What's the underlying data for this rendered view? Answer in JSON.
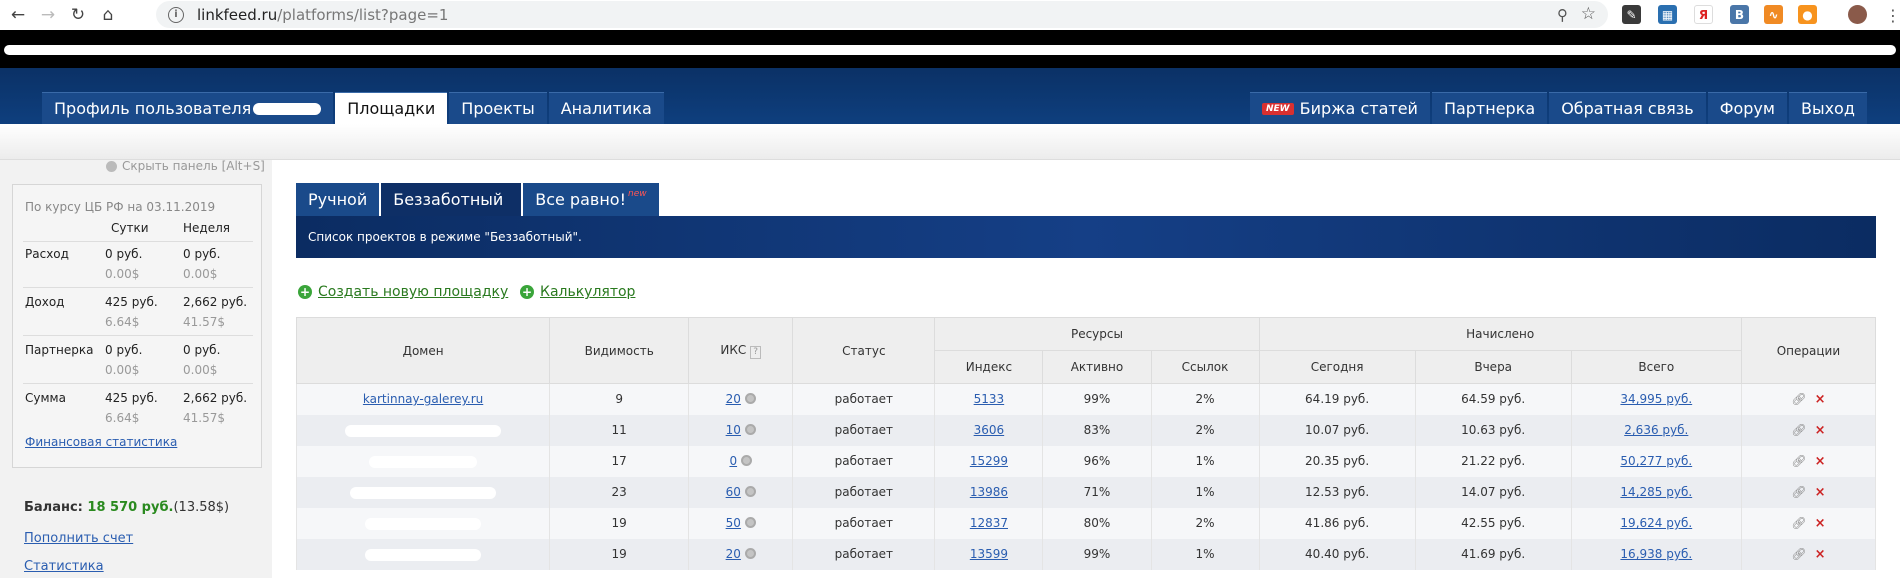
{
  "browser": {
    "url_host": "linkfeed.ru",
    "url_path": "/platforms/list?page=1"
  },
  "header_menu": {
    "left": [
      {
        "label": "Профиль пользователя"
      },
      {
        "label": "Площадки",
        "active": true
      },
      {
        "label": "Проекты"
      },
      {
        "label": "Аналитика"
      }
    ],
    "right": [
      {
        "label": "Биржа статей",
        "badge": "NEW"
      },
      {
        "label": "Партнерка"
      },
      {
        "label": "Обратная связь"
      },
      {
        "label": "Форум"
      },
      {
        "label": "Выход"
      }
    ]
  },
  "sidebar": {
    "hide_panel": "Скрыть панель [Alt+S]",
    "rate_line": "По курсу ЦБ РФ на 03.11.2019",
    "col_day": "Сутки",
    "col_week": "Неделя",
    "rows": [
      {
        "label": "Расход",
        "day_rub": "0 руб.",
        "week_rub": "0 руб.",
        "day_usd": "0.00$",
        "week_usd": "0.00$"
      },
      {
        "label": "Доход",
        "day_rub": "425 руб.",
        "week_rub": "2,662 руб.",
        "day_usd": "6.64$",
        "week_usd": "41.57$"
      },
      {
        "label": "Партнерка",
        "day_rub": "0 руб.",
        "week_rub": "0 руб.",
        "day_usd": "0.00$",
        "week_usd": "0.00$"
      },
      {
        "label": "Сумма",
        "day_rub": "425 руб.",
        "week_rub": "2,662 руб.",
        "day_usd": "6.64$",
        "week_usd": "41.57$"
      }
    ],
    "fin_link": "Финансовая статистика",
    "balance_label": "Баланс:",
    "balance_rub": "18 570 руб.",
    "balance_usd": "(13.58$)",
    "links": [
      "Пополнить счет",
      "Статистика"
    ]
  },
  "tabs": [
    {
      "label": "Ручной"
    },
    {
      "label": "Беззаботный",
      "active": true
    },
    {
      "label": "Все равно!",
      "badge": "new"
    }
  ],
  "banner_text": "Список проектов в режиме \"Беззаботный\".",
  "actions": {
    "create": "Создать новую площадку",
    "calc": "Калькулятор"
  },
  "table": {
    "headers": {
      "domain": "Домен",
      "visibility": "Видимость",
      "iks": "ИКС",
      "iks_hint": "?",
      "status": "Статус",
      "resources": "Ресурсы",
      "index": "Индекс",
      "active": "Активно",
      "links": "Ссылок",
      "accrued": "Начислено",
      "today": "Сегодня",
      "yesterday": "Вчера",
      "total": "Всего",
      "ops": "Операции"
    },
    "rows": [
      {
        "domain": "kartinnay-galerey.ru",
        "visibility": "9",
        "iks": "20",
        "status": "работает",
        "index": "5133",
        "active": "99%",
        "links": "2%",
        "today": "64.19 руб.",
        "yesterday": "64.59 руб.",
        "total": "34,995 руб."
      },
      {
        "domain": "",
        "visibility": "11",
        "iks": "10",
        "status": "работает",
        "index": "3606",
        "active": "83%",
        "links": "2%",
        "today": "10.07 руб.",
        "yesterday": "10.63 руб.",
        "total": "2,636 руб."
      },
      {
        "domain": "",
        "visibility": "17",
        "iks": "0",
        "status": "работает",
        "index": "15299",
        "active": "96%",
        "links": "1%",
        "today": "20.35 руб.",
        "yesterday": "21.22 руб.",
        "total": "50,277 руб."
      },
      {
        "domain": "",
        "visibility": "23",
        "iks": "60",
        "status": "работает",
        "index": "13986",
        "active": "71%",
        "links": "1%",
        "today": "12.53 руб.",
        "yesterday": "14.07 руб.",
        "total": "14,285 руб."
      },
      {
        "domain": "",
        "visibility": "19",
        "iks": "50",
        "status": "работает",
        "index": "12837",
        "active": "80%",
        "links": "2%",
        "today": "41.86 руб.",
        "yesterday": "42.55 руб.",
        "total": "19,624 руб."
      },
      {
        "domain": "",
        "visibility": "19",
        "iks": "20",
        "status": "работает",
        "index": "13599",
        "active": "99%",
        "links": "1%",
        "today": "40.40 руб.",
        "yesterday": "41.69 руб.",
        "total": "16,938 руб."
      }
    ]
  },
  "icons": {
    "back": "back-arrow-icon",
    "forward": "forward-arrow-icon",
    "reload": "reload-icon",
    "home": "home-icon",
    "info": "info-icon",
    "key": "key-icon",
    "star": "star-icon"
  },
  "colors": {
    "header_bg": "#0e3f7e",
    "banner_bg": "#153f86",
    "link": "#2a5db0",
    "balance": "#2a8a1f",
    "delete": "#cc2222"
  }
}
